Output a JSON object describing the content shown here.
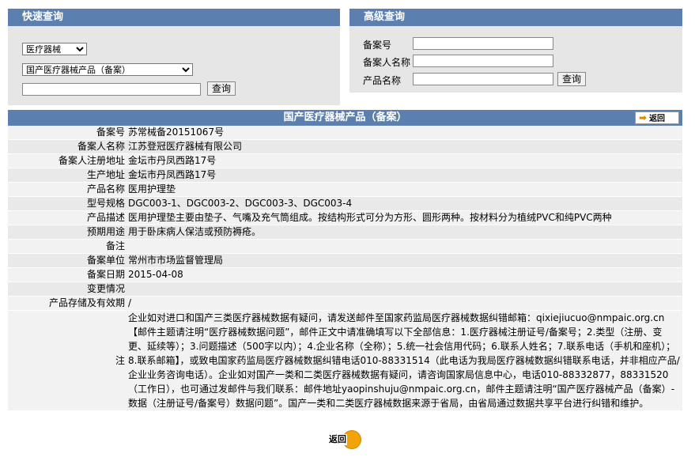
{
  "quick_search": {
    "title": "快速查询",
    "category_select": "医疗器械",
    "type_select": "国产医疗器械产品（备案）",
    "keyword_value": "",
    "search_button": "查询"
  },
  "advanced_search": {
    "title": "高级查询",
    "fields": [
      {
        "label": "备案号",
        "value": ""
      },
      {
        "label": "备案人名称",
        "value": ""
      },
      {
        "label": "产品名称",
        "value": ""
      }
    ],
    "search_button": "查询"
  },
  "detail": {
    "title": "国产医疗器械产品（备案）",
    "back_top": "返回",
    "rows": [
      {
        "key": "备案号",
        "value": "苏常械备20151067号"
      },
      {
        "key": "备案人名称",
        "value": "江苏登冠医疗器械有限公司"
      },
      {
        "key": "备案人注册地址",
        "value": "金坛市丹凤西路17号"
      },
      {
        "key": "生产地址",
        "value": "金坛市丹凤西路17号"
      },
      {
        "key": "产品名称",
        "value": "医用护理垫"
      },
      {
        "key": "型号规格",
        "value": "DGC003-1、DGC003-2、DGC003-3、DGC003-4"
      },
      {
        "key": "产品描述",
        "value": "医用护理垫主要由垫子、气嘴及充气筒组成。按结构形式可分为方形、圆形两种。按材料分为植绒PVC和纯PVC两种"
      },
      {
        "key": "预期用途",
        "value": "用于卧床病人保洁或预防褥疮。"
      },
      {
        "key": "备注",
        "value": ""
      },
      {
        "key": "备案单位",
        "value": "常州市市场监督管理局"
      },
      {
        "key": "备案日期",
        "value": "2015-04-08"
      },
      {
        "key": "变更情况",
        "value": ""
      },
      {
        "key": "产品存储及有效期",
        "value": "/"
      }
    ],
    "note_key": "注",
    "note_text": "企业如对进口和国产三类医疗器械数据有疑问，请发送邮件至国家药监局医疗器械数据纠错邮箱：qixiejiucuo@nmpaic.org.cn【邮件主题请注明“医疗器械数据问题”，邮件正文中请准确填写以下全部信息：1.医疗器械注册证号/备案号；2.类型（注册、变更、延续等）；3.问题描述（500字以内）；4.企业名称（全称）；5.统一社会信用代码；6.联系人姓名；7.联系电话（手机和座机）；8.联系邮箱】，或致电国家药监局医疗器械数据纠错电话010-88331514（此电话为我局医疗器械数据纠错联系电话，并非相应产品/企业业务咨询电话）。企业如对国产一类和二类医疗器械数据有疑问，请咨询国家局信息中心，电话010-88332877，88331520（工作日），也可通过发邮件与我们联系：邮件地址yaopinshuju@nmpaic.org.cn，邮件主题请注明“国产医疗器械产品（备案）-数据（注册证号/备案号）数据问题”。国产一类和二类医疗器械数据来源于省局，由省局通过数据共享平台进行纠错和维护。",
    "back_bottom": "返回"
  },
  "colors": {
    "header_bg": "#5b7fae",
    "panel_bg": "#e6e6e6",
    "note_text": "#1a5f9e",
    "back_icon": "#f2a30a"
  }
}
